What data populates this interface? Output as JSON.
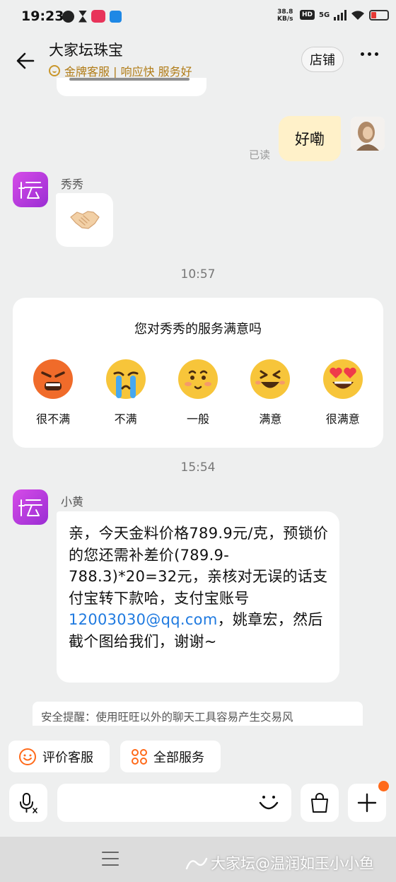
{
  "status_bar": {
    "time": "19:23",
    "net_speed_value": "38.8",
    "net_speed_unit": "KB/s",
    "hd": "HD",
    "network": "5G"
  },
  "header": {
    "title": "大家坛珠宝",
    "subtitle": "金牌客服 | 响应快 服务好",
    "shop_button": "店铺"
  },
  "chat": {
    "my_message": "好嘞",
    "read_status": "已读",
    "agent_1_name": "秀秀",
    "handshake_emoji": "handshake",
    "timestamp_1": "10:57",
    "rating": {
      "title": "您对秀秀的服务满意吗",
      "options": [
        "很不满",
        "不满",
        "一般",
        "满意",
        "很满意"
      ]
    },
    "timestamp_2": "15:54",
    "agent_2_name": "小黄",
    "message": {
      "before_link": "亲，今天金料价格789.9元/克，预锁价的您还需补差价(789.9-788.3)*20=32元，亲核对无误的话支付宝转下款哈，支付宝账号",
      "link": "12003030@qq.com",
      "after_link": "，姚章宏，然后截个图给我们，谢谢~"
    },
    "safety_tip": "安全提醒：使用旺旺以外的聊天工具容易产生交易风"
  },
  "quick_actions": {
    "rate_service": "评价客服",
    "all_services": "全部服务"
  },
  "watermark": "大家坛@温润如玉小小鱼",
  "colors": {
    "background": "#eeefef",
    "my_bubble": "#fff1c9",
    "gold": "#b07b16",
    "link": "#1f7ae0",
    "logo": "#c63fe0",
    "notification_dot": "#ff6a1a"
  }
}
